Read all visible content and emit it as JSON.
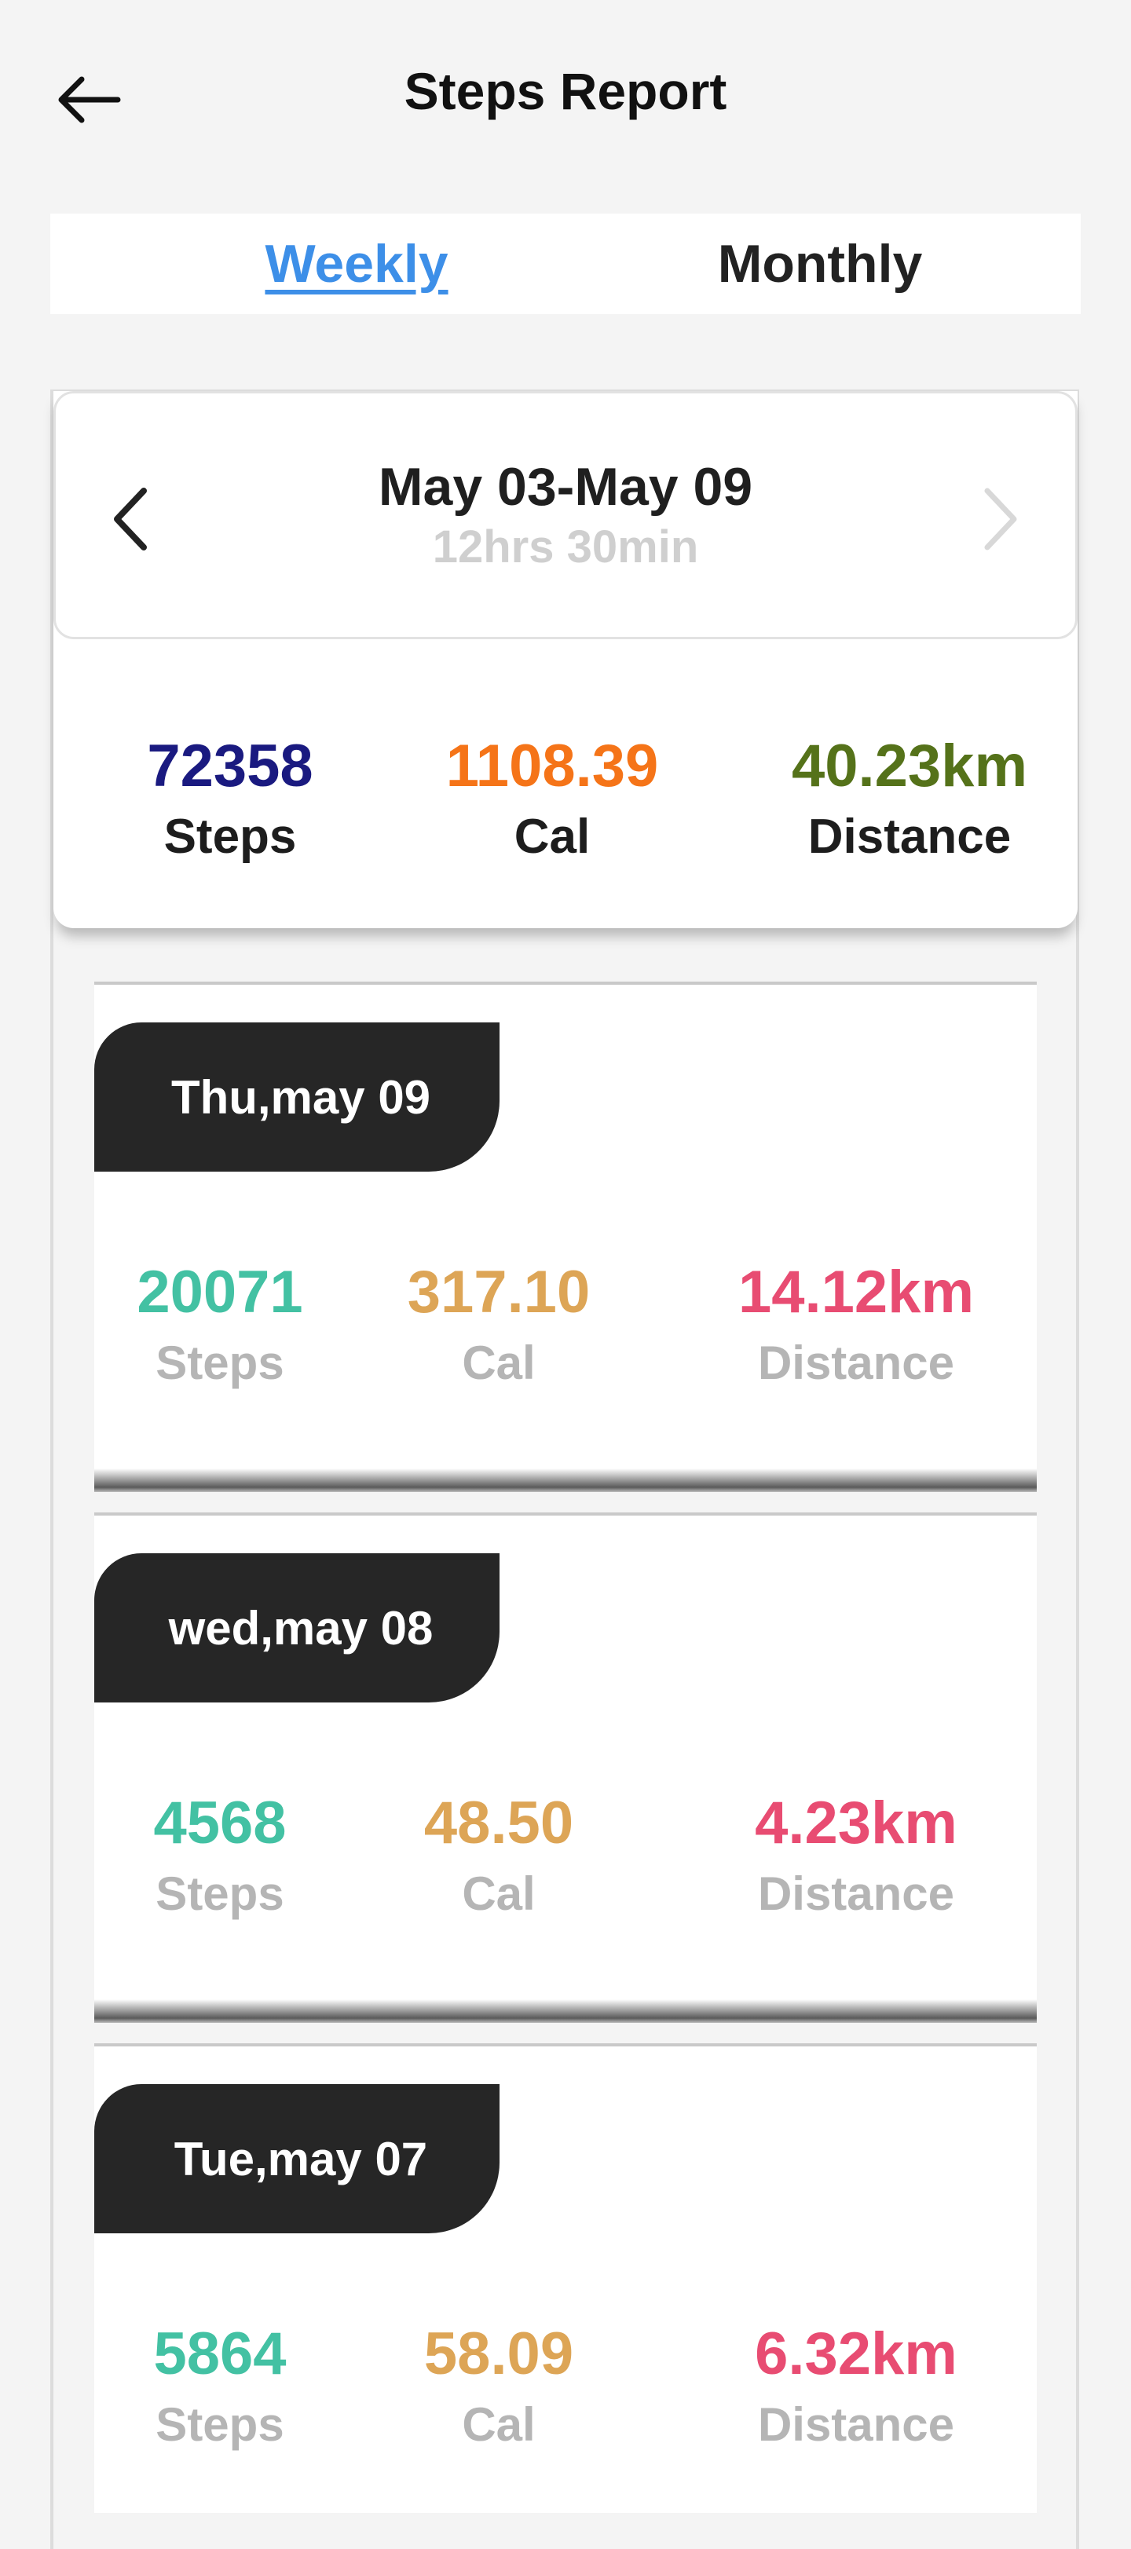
{
  "header": {
    "title": "Steps Report",
    "back_icon": "arrow-left-icon"
  },
  "tabs": [
    {
      "label": "Weekly",
      "active": true
    },
    {
      "label": "Monthly",
      "active": false
    }
  ],
  "summary": {
    "range": "May 03-May 09",
    "duration": "12hrs 30min",
    "prev_icon": "chevron-left-icon",
    "next_icon": "chevron-right-icon",
    "stats": {
      "steps": {
        "value": "72358",
        "label": "Steps",
        "color": "#1a1a80"
      },
      "cal": {
        "value": "1108.39",
        "label": "Cal",
        "color": "#f57418"
      },
      "distance": {
        "value": "40.23km",
        "label": "Distance",
        "color": "#55721a"
      }
    }
  },
  "days": [
    {
      "title": "Thu,may 09",
      "steps": "20071",
      "cal": "317.10",
      "distance": "14.12km"
    },
    {
      "title": "wed,may 08",
      "steps": "4568",
      "cal": "48.50",
      "distance": "4.23km"
    },
    {
      "title": "Tue,may 07",
      "steps": "5864",
      "cal": "58.09",
      "distance": "6.32km"
    }
  ],
  "day_labels": {
    "steps": "Steps",
    "cal": "Cal",
    "distance": "Distance"
  },
  "colors": {
    "steps": "#43c1a3",
    "cal": "#dda556",
    "distance": "#e84c72",
    "active_tab": "#3d8fe8"
  }
}
